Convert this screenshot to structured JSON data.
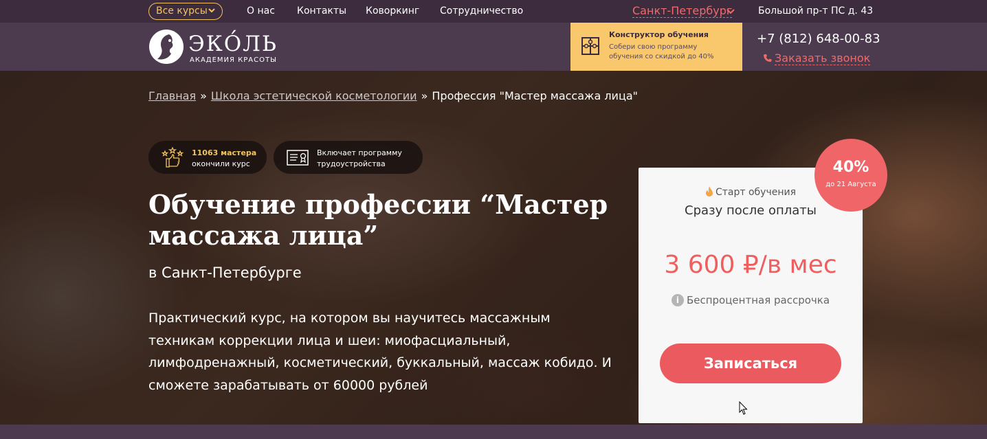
{
  "topbar": {
    "courses_button": "Все курсы",
    "nav": [
      "О нас",
      "Контакты",
      "Коворкинг",
      "Сотрудничество"
    ],
    "city": "Санкт-Петербург",
    "address": "Большой пр-т ПС д. 43"
  },
  "header": {
    "logo_name": "ЭКО́ЛЬ",
    "logo_sub": "АКАДЕМИЯ КРАСОТЫ",
    "constructor_title": "Конструктор обучения",
    "constructor_text": "Собери свою программу обучения со скидкой до 40%",
    "phone": "+7 (812) 648-00-83",
    "callback": "Заказать звонок"
  },
  "breadcrumb": {
    "home": "Главная",
    "section": "Школа эстетической косметологии",
    "current": "Профессия \"Мастер массажа лица\"",
    "separator": "»"
  },
  "badges": {
    "graduates_line1": "11063 мастера",
    "graduates_line2": "окончили курс",
    "employment_line1": "Включает программу",
    "employment_line2": "трудоустройства"
  },
  "hero": {
    "title": "Обучение профессии “Мастер массажа лица”",
    "subtitle": "в Санкт-Петербурге",
    "description": "Практический курс, на котором вы научитесь массажным техникам коррекции лица и шеи: миофасциальный, лимфодренажный, косметический, буккальный, массаж кобидо. И сможете зарабатывать от 60000 рублей"
  },
  "price_card": {
    "start_label": "Старт обучения",
    "start_value": "Сразу после оплаты",
    "price": "3 600 ₽/в мес",
    "installment": "Беспроцентная рассрочка",
    "signup_button": "Записаться",
    "discount_value": "40%",
    "discount_note": "до 21 Августа"
  },
  "colors": {
    "accent_red": "#ea5a5e",
    "accent_yellow": "#f9c86c",
    "header_purple": "#4c3a4e"
  }
}
